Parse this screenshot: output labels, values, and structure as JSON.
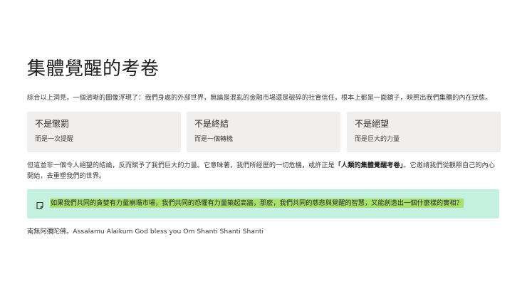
{
  "title": "集體覺醒的考卷",
  "intro": "綜合以上洞見，一個清晰的圖像浮現了：我們身處的外部世界，無論是混亂的金融市場還是破碎的社會信任，根本上都是一面鏡子，映照出我們集體的內在狀態。",
  "cards": [
    {
      "title": "不是懲罰",
      "subtitle": "而是一次提醒"
    },
    {
      "title": "不是終結",
      "subtitle": "而是一個轉機"
    },
    {
      "title": "不是絕望",
      "subtitle": "而是巨大的力量"
    }
  ],
  "body": {
    "part1": "但這並非一個令人絕望的結論，反而賦予了我們巨大的力量。它意味著，我們所經歷的一切危機，或許正是",
    "bold": "「人類的集體覺醒考卷」",
    "part2": "。它邀請我們從觀照自己的內心開始，去重塑我們的世界。"
  },
  "callout": {
    "icon": "note-icon",
    "text": "如果我們共同的貪婪有力量崩塌市場，我們共同的恐懼有力量築起高牆，那麼，我們共同的慈悲與覺醒的智慧，又能創造出一個什麼樣的實相？",
    "background": "#c4f1df",
    "highlight": "#a8e06e"
  },
  "blessing": "南無阿彌陀佛。Assalamu Alaikum God bless you Om Shanti Shanti Shanti"
}
